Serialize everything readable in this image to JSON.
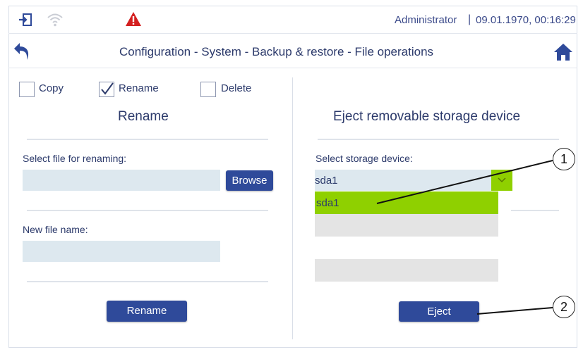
{
  "statusbar": {
    "user": "Administrator",
    "separator": "|",
    "datetime": "09.01.1970, 00:16:29",
    "colors": {
      "alert": "#d42020",
      "icons": "#2f4a9a"
    }
  },
  "nav": {
    "title": "Configuration - System - Backup & restore - File operations"
  },
  "operations": {
    "copy_label": "Copy",
    "copy_checked": false,
    "rename_label": "Rename",
    "rename_checked": true,
    "delete_label": "Delete",
    "delete_checked": false
  },
  "rename_panel": {
    "title": "Rename",
    "select_file_label": "Select file for renaming:",
    "select_file_value": "",
    "browse_label": "Browse",
    "new_name_label": "New file name:",
    "new_name_value": "",
    "rename_button": "Rename"
  },
  "eject_panel": {
    "title": "Eject removable storage device",
    "select_device_label": "Select storage device:",
    "selected_device": "sda1",
    "options": [
      "sda1",
      "",
      "",
      "",
      ""
    ],
    "eject_button": "Eject"
  },
  "callouts": {
    "one": "1",
    "two": "2"
  },
  "colors": {
    "accent": "#2f4a9a",
    "highlight": "#8fd000",
    "input_bg": "#dde8ef"
  }
}
